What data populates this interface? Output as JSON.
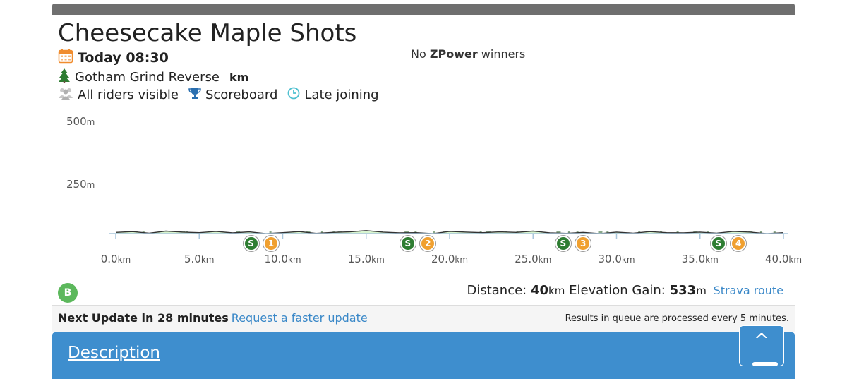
{
  "event": {
    "title": "Cheesecake Maple Shots",
    "date": "Today 08:30",
    "route": "Gotham Grind Reverse",
    "unit": "km",
    "visibility": "All riders visible",
    "scoreboard": "Scoreboard",
    "late_joining": "Late joining",
    "zpower_prefix": "No",
    "zpower_name": "ZPower",
    "zpower_suffix": "winners",
    "category_badge": "B"
  },
  "icons": {
    "calendar": "calendar-icon",
    "tree": "tree-icon",
    "riders": "riders-icon",
    "trophy": "trophy-icon",
    "clock": "clock-icon"
  },
  "colors": {
    "header_bar": "#6f6f6f",
    "elevation_fill": "#d8f5d0",
    "climb_segments": "#8aa88a",
    "sprint_marker": "#2e7d32",
    "segment_number": "#f0a030",
    "category_badge": "#5cb85c",
    "link": "#3a88c8",
    "description_bar": "#3e8ece"
  },
  "chart_data": {
    "type": "area",
    "title": "",
    "xlabel": "",
    "ylabel": "",
    "x_unit": "km",
    "y_unit": "m",
    "xlim": [
      0,
      40
    ],
    "ylim": [
      0,
      500
    ],
    "x_ticks": [
      {
        "value": 0,
        "label": "0.0",
        "unit": "km"
      },
      {
        "value": 5,
        "label": "5.0",
        "unit": "km"
      },
      {
        "value": 10,
        "label": "10.0",
        "unit": "km"
      },
      {
        "value": 15,
        "label": "15.0",
        "unit": "km"
      },
      {
        "value": 20,
        "label": "20.0",
        "unit": "km"
      },
      {
        "value": 25,
        "label": "25.0",
        "unit": "km"
      },
      {
        "value": 30,
        "label": "30.0",
        "unit": "km"
      },
      {
        "value": 35,
        "label": "35.0",
        "unit": "km"
      },
      {
        "value": 40,
        "label": "40.0",
        "unit": "km"
      }
    ],
    "y_ticks": [
      {
        "value": 500,
        "label": "500",
        "unit": "m"
      },
      {
        "value": 250,
        "label": "250",
        "unit": "m"
      }
    ],
    "x": [
      0,
      1,
      2,
      3,
      4,
      5,
      6,
      7,
      8,
      9,
      10,
      11,
      12,
      13,
      14,
      15,
      16,
      17,
      18,
      19,
      20,
      21,
      22,
      23,
      24,
      25,
      26,
      27,
      28,
      29,
      30,
      31,
      32,
      33,
      34,
      35,
      36,
      37,
      38,
      39,
      40
    ],
    "y": [
      75,
      78,
      72,
      80,
      76,
      74,
      79,
      73,
      77,
      70,
      74,
      78,
      71,
      75,
      77,
      82,
      76,
      73,
      74,
      70,
      79,
      76,
      74,
      77,
      75,
      80,
      73,
      71,
      75,
      70,
      76,
      72,
      78,
      74,
      73,
      76,
      72,
      79,
      76,
      70,
      74
    ],
    "markers": [
      {
        "type": "sprint",
        "label": "S",
        "km": 8.1
      },
      {
        "type": "segment",
        "label": "1",
        "km": 9.3
      },
      {
        "type": "sprint",
        "label": "S",
        "km": 17.5
      },
      {
        "type": "segment",
        "label": "2",
        "km": 18.7
      },
      {
        "type": "sprint",
        "label": "S",
        "km": 26.8
      },
      {
        "type": "segment",
        "label": "3",
        "km": 28.0
      },
      {
        "type": "sprint",
        "label": "S",
        "km": 36.1
      },
      {
        "type": "segment",
        "label": "4",
        "km": 37.3
      }
    ]
  },
  "stats": {
    "distance_label": "Distance:",
    "distance_value": "40",
    "distance_unit": "km",
    "elevation_label": "Elevation Gain:",
    "elevation_value": "533",
    "elevation_unit": "m",
    "strava_link": "Strava route"
  },
  "footer": {
    "next_update": "Next Update in 28 minutes",
    "faster_update_link": "Request a faster update",
    "queue_note": "Results in queue are processed every 5 minutes."
  },
  "description": {
    "link_label": "Description",
    "up_arrow": "^"
  }
}
